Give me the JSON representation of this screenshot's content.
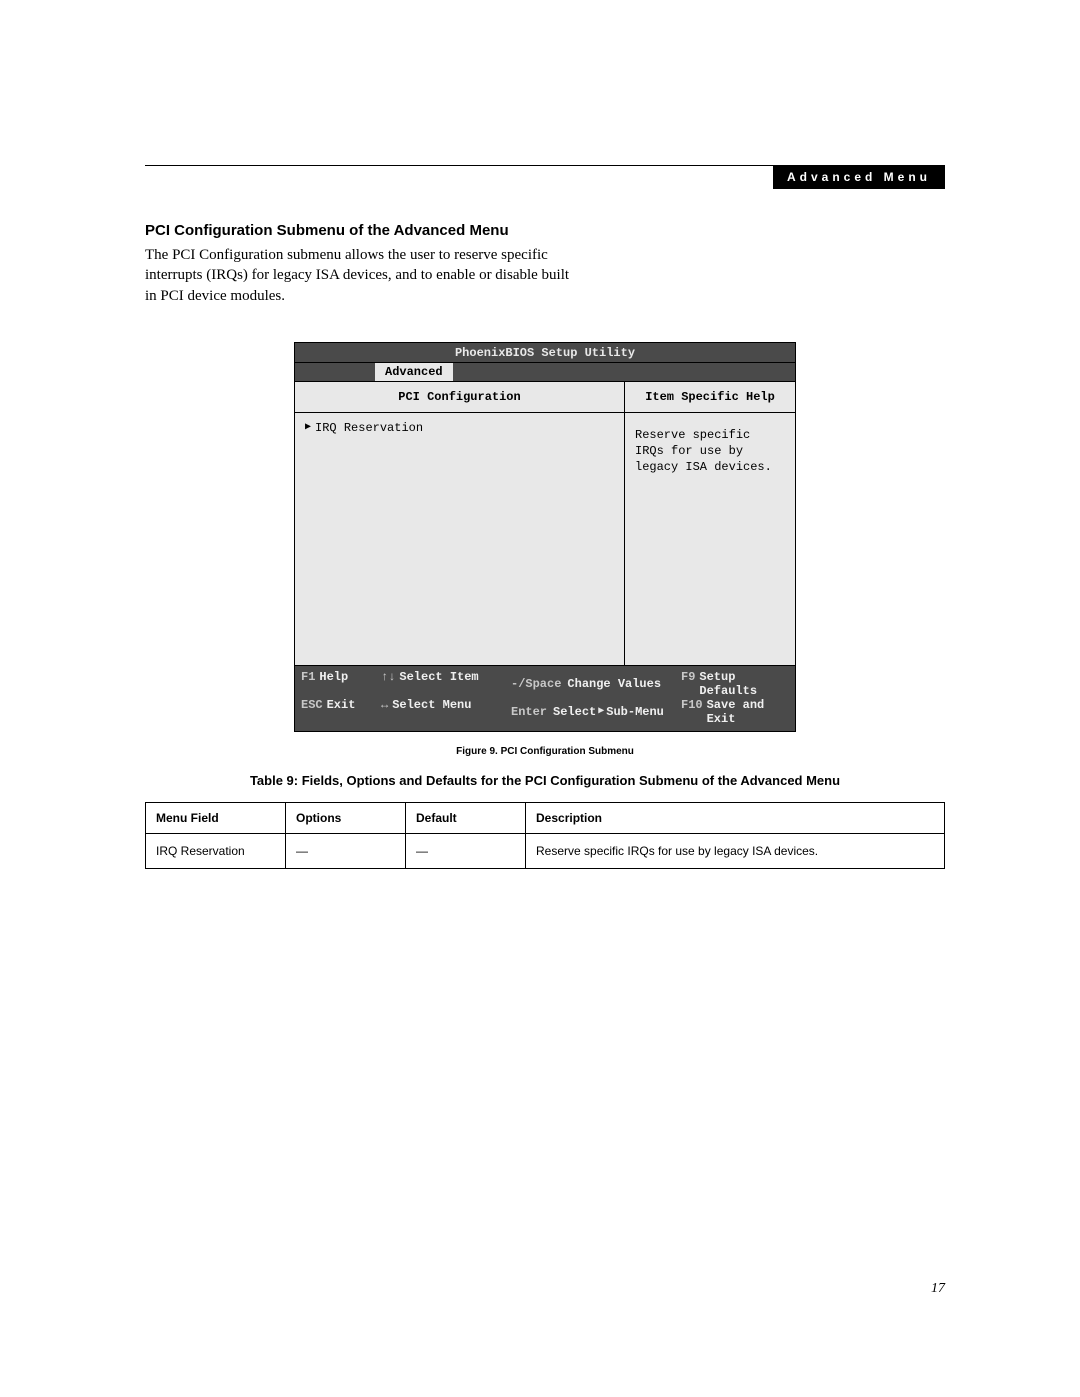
{
  "header": {
    "badge": "Advanced Menu"
  },
  "section": {
    "heading": "PCI Configuration Submenu of the Advanced Menu",
    "body": "The PCI Configuration submenu allows the user to reserve specific interrupts (IRQs) for legacy ISA devices, and to enable or disable built in PCI device modules."
  },
  "bios": {
    "title": "PhoenixBIOS Setup Utility",
    "active_tab": "Advanced",
    "left_heading": "PCI Configuration",
    "right_heading": "Item Specific Help",
    "menu_item": "IRQ Reservation",
    "help_text": "Reserve specific IRQs for use by legacy ISA devices.",
    "footer": {
      "r1": {
        "k1": "F1",
        "l1": "Help",
        "k2": "↑↓",
        "l2": "Select Item",
        "k3": "-/Space",
        "l3": "Change Values",
        "k4": "F9",
        "l4": "Setup Defaults"
      },
      "r2": {
        "k1": "ESC",
        "l1": "Exit",
        "k2": "↔",
        "l2": "Select Menu",
        "k3": "Enter",
        "l3t": "Select",
        "l3b": "Sub-Menu",
        "k4": "F10",
        "l4": "Save and Exit"
      }
    }
  },
  "figure_caption": "Figure 9.  PCI Configuration Submenu",
  "table_title": "Table 9: Fields, Options and Defaults for  the PCI Configuration Submenu of the Advanced Menu",
  "table": {
    "headers": {
      "menu_field": "Menu Field",
      "options": "Options",
      "default": "Default",
      "description": "Description"
    },
    "rows": [
      {
        "menu_field": "IRQ Reservation",
        "options": "—",
        "default": "—",
        "description": "Reserve specific IRQs for use by legacy ISA devices."
      }
    ]
  },
  "page_number": "17"
}
